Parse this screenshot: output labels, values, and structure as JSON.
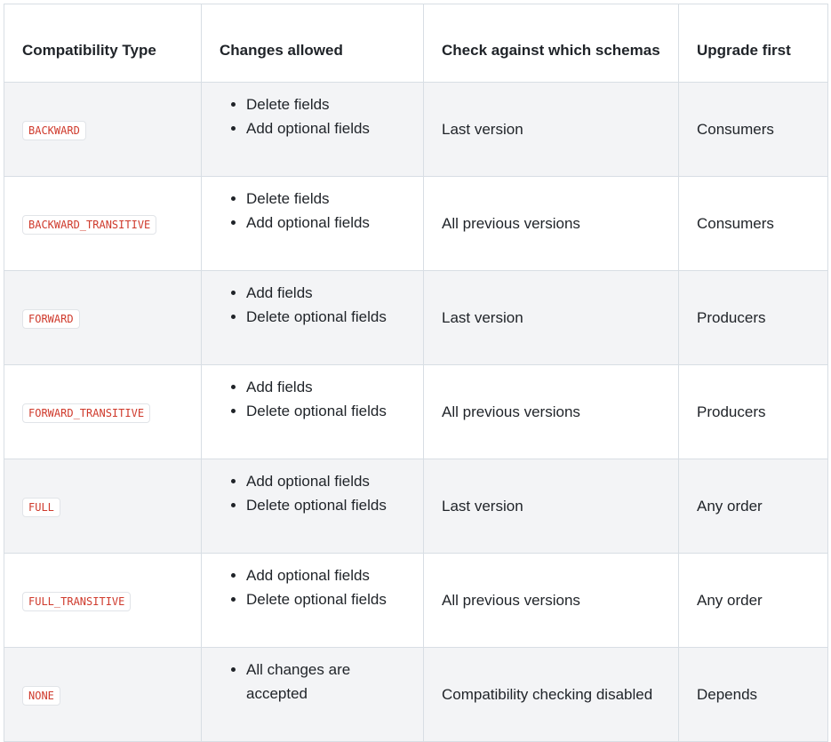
{
  "headers": {
    "type": "Compatibility Type",
    "changes": "Changes allowed",
    "check": "Check against which schemas",
    "upgrade": "Upgrade first"
  },
  "rows": [
    {
      "type": "BACKWARD",
      "changes": [
        "Delete fields",
        "Add optional fields"
      ],
      "check": "Last version",
      "upgrade": "Consumers"
    },
    {
      "type": "BACKWARD_TRANSITIVE",
      "changes": [
        "Delete fields",
        "Add optional fields"
      ],
      "check": "All previous versions",
      "upgrade": "Consumers"
    },
    {
      "type": "FORWARD",
      "changes": [
        "Add fields",
        "Delete optional fields"
      ],
      "check": "Last version",
      "upgrade": "Producers"
    },
    {
      "type": "FORWARD_TRANSITIVE",
      "changes": [
        "Add fields",
        "Delete optional fields"
      ],
      "check": "All previous versions",
      "upgrade": "Producers"
    },
    {
      "type": "FULL",
      "changes": [
        "Add optional fields",
        "Delete optional fields"
      ],
      "check": "Last version",
      "upgrade": "Any order"
    },
    {
      "type": "FULL_TRANSITIVE",
      "changes": [
        "Add optional fields",
        "Delete optional fields"
      ],
      "check": "All previous versions",
      "upgrade": "Any order"
    },
    {
      "type": "NONE",
      "changes": [
        "All changes are accepted"
      ],
      "check": "Compatibility checking disabled",
      "upgrade": "Depends"
    }
  ],
  "colors": {
    "code_text": "#cf3a2c",
    "stripe": "#f3f4f6",
    "border": "#d8dee4"
  }
}
